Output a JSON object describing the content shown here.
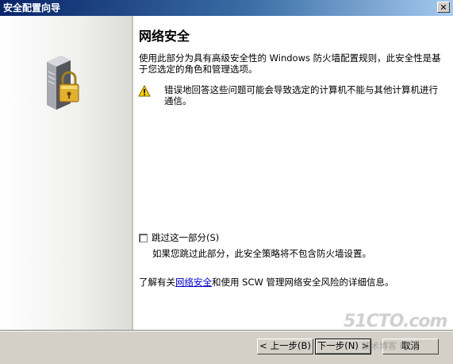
{
  "window": {
    "title": "安全配置向导",
    "close_glyph": "✕"
  },
  "page": {
    "title": "网络安全",
    "description": "使用此部分为具有高级安全性的 Windows 防火墙配置规则，此安全性是基于您选定的角色和管理选项。",
    "warning": "错误地回答这些问题可能会导致选定的计算机不能与其他计算机进行通信。",
    "skip_label": "跳过这一部分(S)",
    "skip_checked": false,
    "skip_desc": "如果您跳过此部分，此安全策略将不包含防火墙设置。",
    "learn_prefix": "了解有关",
    "learn_link": "网络安全",
    "learn_suffix": "和使用 SCW 管理网络安全风险的详细信息。"
  },
  "buttons": {
    "back": "< 上一步(B)",
    "next": "下一步(N) >",
    "cancel": "取消"
  },
  "watermark": {
    "main": "51CTO.com",
    "sub": "技术博客 Blog"
  },
  "icons": {
    "server": "server-lock-icon",
    "warning": "warning-icon"
  },
  "colors": {
    "title_bar": "#0a246a",
    "link": "#0000cc",
    "warning": "#ffd700"
  }
}
